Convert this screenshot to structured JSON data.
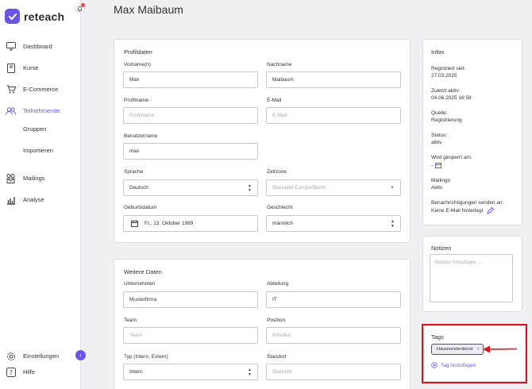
{
  "brand": {
    "name": "reteach",
    "accent": "#6b55e6"
  },
  "sidebar": {
    "items": [
      {
        "label": "Dashboard",
        "icon": "monitor-icon"
      },
      {
        "label": "Kurse",
        "icon": "book-icon"
      },
      {
        "label": "E-Commerce",
        "icon": "cart-icon"
      },
      {
        "label": "Teilnehmende",
        "icon": "users-icon"
      },
      {
        "label": "Gruppen"
      },
      {
        "label": "Importieren"
      },
      {
        "label": "Mailings",
        "icon": "mail-users-icon"
      },
      {
        "label": "Analyse",
        "icon": "chart-icon"
      }
    ],
    "footer": [
      {
        "label": "Einstellungen",
        "icon": "gear-icon"
      },
      {
        "label": "Hilfe",
        "icon": "help-icon"
      }
    ]
  },
  "page": {
    "title": "Max Maibaum"
  },
  "profile": {
    "title": "Profildaten",
    "firstname_label": "Vorname(n)",
    "firstname": "Max",
    "lastname_label": "Nachname",
    "lastname": "Maibaum",
    "profilename_label": "Profilname",
    "profilename_placeholder": "Profilname",
    "email_label": "E-Mail",
    "email_placeholder": "E-Mail",
    "username_label": "Benutzername",
    "username": "max",
    "language_label": "Sprache",
    "language": "Deutsch",
    "timezone_label": "Zeitzone",
    "timezone": "Standard Europe/Berlin",
    "birthdate_label": "Geburtsdatum",
    "birthdate": "Fr., 13. Oktober 1989",
    "gender_label": "Geschlecht",
    "gender": "männlich"
  },
  "more": {
    "title": "Weitere Daten",
    "company_label": "Unternehmen",
    "company": "Musterfirma",
    "department_label": "Abteilung",
    "department": "IT",
    "team_label": "Team",
    "team_placeholder": "Team",
    "position_label": "Position",
    "position_placeholder": "Position",
    "type_label": "Typ (Intern, Extern)",
    "type": "Intern",
    "location_label": "Standort",
    "location_placeholder": "Standort"
  },
  "infos": {
    "title": "Infos",
    "registered_label": "Registriert seit:",
    "registered": "27.03.2025",
    "last_active_label": "Zuletzt aktiv:",
    "last_active": "04.06.2025 16:58",
    "source_label": "Quelle:",
    "source": "Registrierung",
    "status_label": "Status:",
    "status": "aktiv",
    "blocked_label": "Wird gesperrt am:",
    "blocked": "-",
    "mailings_label": "Mailings:",
    "mailings": "Aktiv",
    "notify_label": "Benachrichtigungen senden an:",
    "notify": "Keine E-Mail hinterlegt"
  },
  "notes": {
    "title": "Notizen",
    "placeholder": "Notizen hinzufügen ..."
  },
  "tags": {
    "title": "Tags",
    "items": [
      "Hausmeisterdienst"
    ],
    "add_label": "Tag hinzufügen"
  }
}
